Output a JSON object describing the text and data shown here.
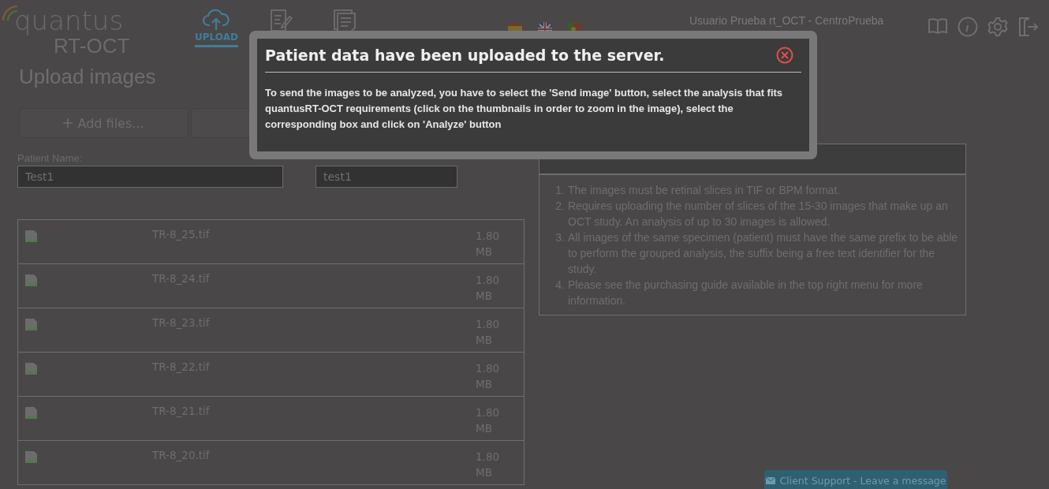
{
  "header": {
    "logo": {
      "name": "quantus",
      "product": "RT-OCT"
    },
    "nav": [
      {
        "kind": "upload",
        "label": "UPLOAD",
        "selected": true
      },
      {
        "kind": "edit",
        "selected": false
      },
      {
        "kind": "documents",
        "selected": false
      }
    ],
    "user": "Usuario Prueba rt_OCT - CentroPrueba"
  },
  "page_title": "Upload images",
  "buttons": [
    {
      "kind": "add",
      "label": "Add files..."
    },
    {
      "kind": "upload"
    }
  ],
  "fields": [
    {
      "label": "Patient Name:",
      "value": "Test1"
    },
    {
      "value": "test1"
    }
  ],
  "files": [
    {
      "name": "TR-8_25.tif",
      "size": "1.80 MB"
    },
    {
      "name": "TR-8_24.tif",
      "size": "1.80 MB"
    },
    {
      "name": "TR-8_23.tif",
      "size": "1.80 MB"
    },
    {
      "name": "TR-8_22.tif",
      "size": "1.80 MB"
    },
    {
      "name": "TR-8_21.tif",
      "size": "1.80 MB"
    },
    {
      "name": "TR-8_20.tif",
      "size": "1.80 MB"
    }
  ],
  "requirements": [
    {
      "marker": "1.",
      "text": "The images must be retinal slices in TIF or BPM format."
    },
    {
      "marker": "2.",
      "text": "Requires uploading the number of slices of the 15-30 images that make up an OCT study. An analysis of up to 30 images is allowed."
    },
    {
      "marker": "3.",
      "text": "All images of the same specimen (patient) must have the same prefix to be able to perform the grouped analysis, the suffix being a free text identifier for the study."
    },
    {
      "marker": "4.",
      "text": "Please see the purchasing guide available in the top right menu for more information."
    }
  ],
  "modal": {
    "title": "Patient data have been uploaded to the server.",
    "text": "To send the images to be analyzed, you have to select the 'Send image' button, select the analysis that fits quantusRT-OCT requirements (click on the thumbnails in order to zoom in the image), select the corresponding box and click on 'Analyze' button"
  },
  "support": "Client Support - Leave a message"
}
